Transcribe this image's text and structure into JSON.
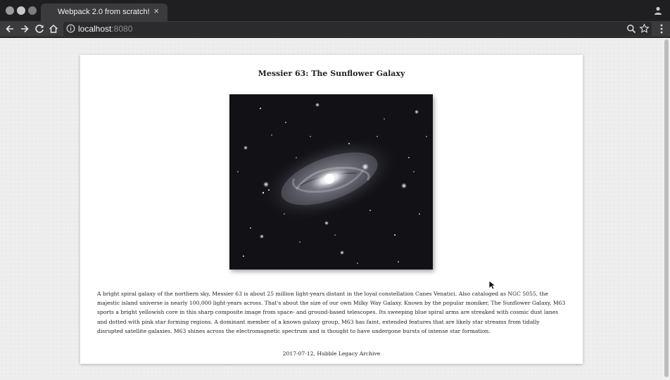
{
  "browser": {
    "tab_title": "Webpack 2.0 from scratch!",
    "tab_close": "×",
    "url_host": "localhost",
    "url_port": ":8080"
  },
  "icons": {
    "back": "back-arrow-icon",
    "forward": "forward-arrow-icon",
    "reload": "reload-icon",
    "home": "home-icon",
    "info": "info-icon",
    "zoom": "zoom-icon",
    "bookmark": "star-icon",
    "menu": "kebab-menu-icon",
    "profile": "user-icon"
  },
  "colors": {
    "chrome_dark": "#1f1f21",
    "toolbar": "#3b3b3e",
    "page_bg": "#eeeeee",
    "card_bg": "#ffffff"
  },
  "article": {
    "title": "Messier 63: The Sunflower Galaxy",
    "image_alt": "Messier 63 spiral galaxy",
    "description": "A bright spiral galaxy of the northern sky, Messier 63 is about 25 million light-years distant in the loyal constellation Canes Venatici. Also cataloged as NGC 5055, the majestic island universe is nearly 100,000 light-years across. That's about the size of our own Milky Way Galaxy. Known by the popular moniker, The Sunflower Galaxy, M63 sports a bright yellowish core in this sharp composite image from space- and ground-based telescopes. Its sweeping blue spiral arms are streaked with cosmic dust lanes and dotted with pink star forming regions. A dominant member of a known galaxy group, M63 has faint, extended features that are likely star streams from tidally disrupted satellite galaxies. M63 shines across the electromagnetic spectrum and is thought to have undergone bursts of intense star formation.",
    "caption": "2017-07-12, Hubble Legacy Archive"
  }
}
